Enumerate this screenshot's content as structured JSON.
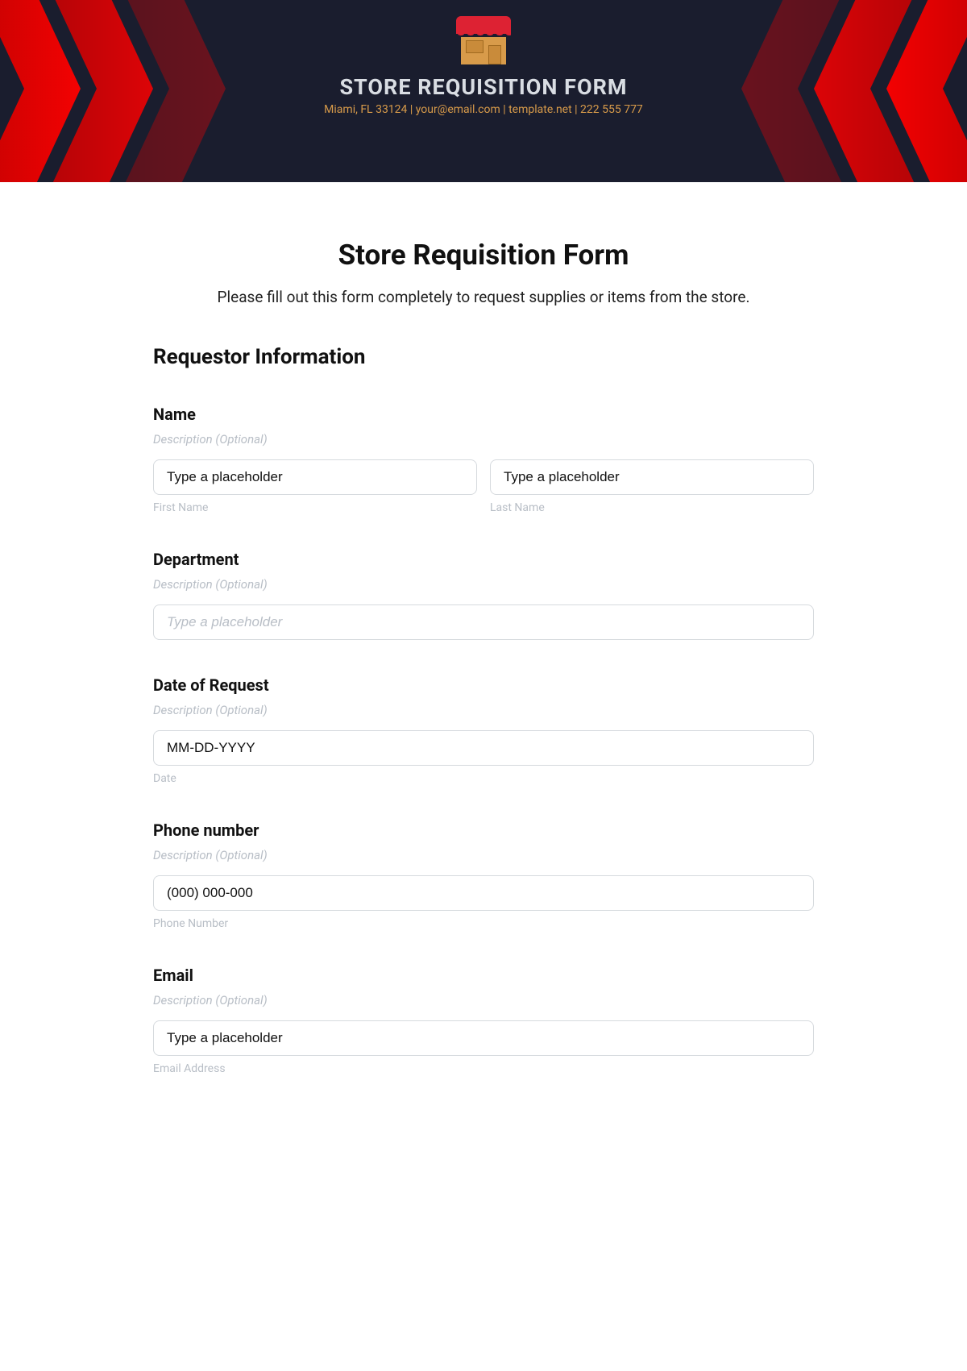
{
  "banner": {
    "title": "STORE REQUISITION FORM",
    "sub": "Miami, FL 33124 | your@email.com | template.net | 222 555 777"
  },
  "page": {
    "title": "Store Requisition Form",
    "intro": "Please fill out this form completely to request supplies or items from the store."
  },
  "section": {
    "requestor": "Requestor Information"
  },
  "name": {
    "label": "Name",
    "desc": "Description (Optional)",
    "first_value": "Type a placeholder",
    "last_value": "Type a placeholder",
    "first_sub": "First Name",
    "last_sub": "Last Name"
  },
  "department": {
    "label": "Department",
    "desc": "Description (Optional)",
    "placeholder": "Type a placeholder"
  },
  "date": {
    "label": "Date of Request",
    "desc": "Description (Optional)",
    "value": "MM-DD-YYYY",
    "sub": "Date"
  },
  "phone": {
    "label": "Phone number",
    "desc": "Description (Optional)",
    "value": "(000) 000-000",
    "sub": "Phone Number"
  },
  "email": {
    "label": "Email",
    "desc": "Description (Optional)",
    "value": "Type a placeholder",
    "sub": "Email Address"
  }
}
